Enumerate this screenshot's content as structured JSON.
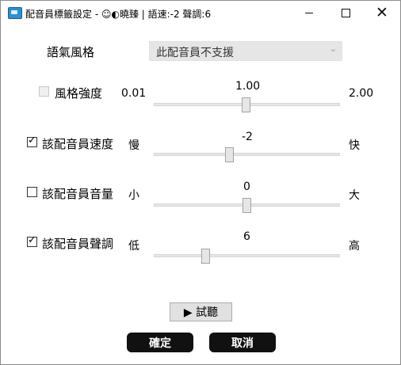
{
  "window": {
    "title": "配音員標籤設定 - ☺◐曉臻 | 語速:-2 聲調:6",
    "app_icon": "app-logo-icon",
    "controls": {
      "minimize": "minimize-icon",
      "maximize": "maximize-icon",
      "close": "close-icon"
    }
  },
  "style": {
    "label": "語氣風格",
    "value": "此配音員不支援",
    "dropdown_icon": "chevron-down-icon"
  },
  "sliders": [
    {
      "id": "style-strength",
      "label": "風格強度",
      "checked": false,
      "enabled": false,
      "min_label": "0.01",
      "max_label": "2.00",
      "value": "1.00",
      "range": [
        0.01,
        2.0
      ],
      "num": 1.0
    },
    {
      "id": "rate",
      "label": "該配音員速度",
      "checked": true,
      "enabled": true,
      "min_label": "慢",
      "max_label": "快",
      "value": "-2",
      "range": [
        -10,
        10
      ],
      "num": -2
    },
    {
      "id": "volume",
      "label": "該配音員音量",
      "checked": false,
      "enabled": true,
      "min_label": "小",
      "max_label": "大",
      "value": "0",
      "range": [
        -10,
        10
      ],
      "num": 0
    },
    {
      "id": "pitch",
      "label": "該配音員聲調",
      "checked": true,
      "enabled": true,
      "min_label": "低",
      "max_label": "高",
      "value": "6",
      "range": [
        -10,
        50
      ],
      "num": 6
    }
  ],
  "buttons": {
    "listen": "▶ 試聽",
    "ok": "確定",
    "cancel": "取消"
  },
  "colors": {
    "button_dark": "#111111",
    "track": "#e7e7e7"
  }
}
